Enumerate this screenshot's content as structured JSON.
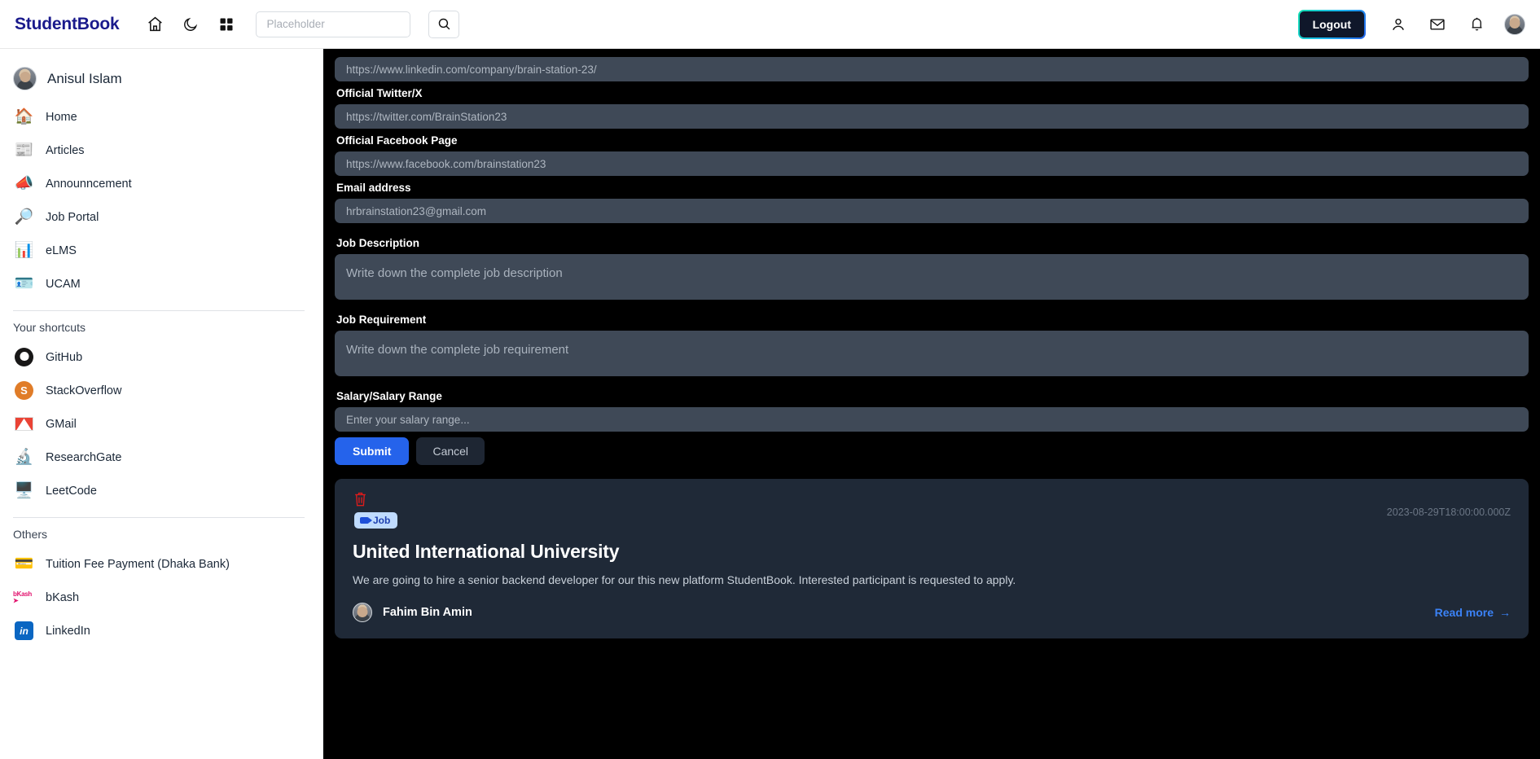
{
  "header": {
    "brand": "StudentBook",
    "icons": [
      "home-icon",
      "moon-icon",
      "grid-icon"
    ],
    "search_placeholder": "Placeholder",
    "search_value": "",
    "search_button": "search-icon",
    "logout_label": "Logout",
    "right_icons": [
      "user-icon",
      "mail-icon",
      "bell-icon",
      "avatar"
    ]
  },
  "sidebar": {
    "user_name": "Anisul Islam",
    "nav": [
      {
        "label": "Home",
        "icon": "🏠"
      },
      {
        "label": "Articles",
        "icon": "📰"
      },
      {
        "label": "Announncement",
        "icon": "📣"
      },
      {
        "label": "Job Portal",
        "icon": "🔎"
      },
      {
        "label": "eLMS",
        "icon": "📊"
      },
      {
        "label": "UCAM",
        "icon": "🪪"
      }
    ],
    "shortcuts_heading": "Your shortcuts",
    "shortcuts": [
      {
        "label": "GitHub",
        "icon": "github-icon"
      },
      {
        "label": "StackOverflow",
        "icon": "stackoverflow-icon"
      },
      {
        "label": "GMail",
        "icon": "gmail-icon"
      },
      {
        "label": "ResearchGate",
        "icon": "🔬"
      },
      {
        "label": "LeetCode",
        "icon": "🖥️"
      }
    ],
    "others_heading": "Others",
    "others": [
      {
        "label": "Tuition Fee Payment (Dhaka Bank)",
        "icon": "💳"
      },
      {
        "label": "bKash",
        "icon": "bkash-icon"
      },
      {
        "label": "LinkedIn",
        "icon": "linkedin-icon"
      }
    ]
  },
  "form": {
    "linkedin_value": "https://www.linkedin.com/company/brain-station-23/",
    "twitter_label": "Official Twitter/X",
    "twitter_value": "https://twitter.com/BrainStation23",
    "facebook_label": "Official Facebook Page",
    "facebook_value": "https://www.facebook.com/brainstation23",
    "email_label": "Email address",
    "email_value": "hrbrainstation23@gmail.com",
    "description_label": "Job Description",
    "description_placeholder": "Write down the complete job description",
    "requirement_label": "Job Requirement",
    "requirement_placeholder": "Write down the complete job requirement",
    "salary_label": "Salary/Salary Range",
    "salary_placeholder": "Enter your salary range...",
    "submit_label": "Submit",
    "cancel_label": "Cancel"
  },
  "post": {
    "delete_icon": "trash-icon",
    "badge_label": "Job",
    "timestamp": "2023-08-29T18:00:00.000Z",
    "title": "United International University",
    "description": "We are going to hire a senior backend developer for our this new platform StudentBook. Interested participant is requested to apply.",
    "author": "Fahim Bin Amin",
    "read_more": "Read more",
    "read_more_arrow": "→"
  },
  "colors": {
    "brand": "#1a1a8c",
    "primary": "#2563eb",
    "main_bg": "#000000",
    "input_bg": "#3f4957",
    "card_bg": "#1f2937",
    "badge_bg": "#bfdbfe",
    "danger": "#e01b1b",
    "link": "#3b82f6"
  }
}
